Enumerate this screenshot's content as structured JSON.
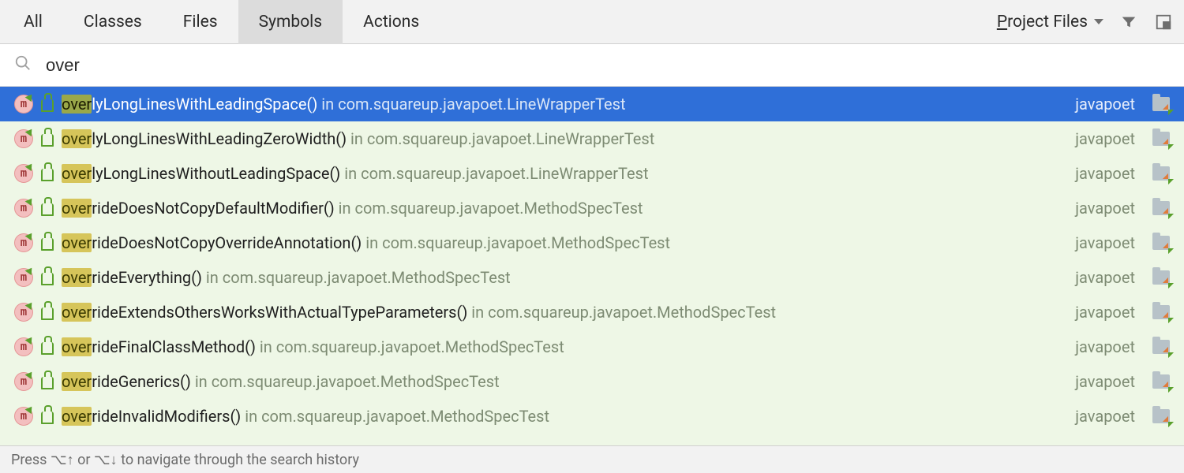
{
  "tabs": {
    "all": "All",
    "classes": "Classes",
    "files": "Files",
    "symbols": "Symbols",
    "actions": "Actions",
    "active": "symbols"
  },
  "scope": {
    "prefix": "P",
    "rest": "roject Files"
  },
  "search": {
    "value": "over",
    "highlight": "over"
  },
  "module": "javapoet",
  "results": [
    {
      "name": "overlyLongLinesWithLeadingSpace()",
      "in": " in com.squareup.javapoet.LineWrapperTest",
      "selected": true
    },
    {
      "name": "overlyLongLinesWithLeadingZeroWidth()",
      "in": " in com.squareup.javapoet.LineWrapperTest",
      "selected": false
    },
    {
      "name": "overlyLongLinesWithoutLeadingSpace()",
      "in": " in com.squareup.javapoet.LineWrapperTest",
      "selected": false
    },
    {
      "name": "overrideDoesNotCopyDefaultModifier()",
      "in": " in com.squareup.javapoet.MethodSpecTest",
      "selected": false
    },
    {
      "name": "overrideDoesNotCopyOverrideAnnotation()",
      "in": " in com.squareup.javapoet.MethodSpecTest",
      "selected": false
    },
    {
      "name": "overrideEverything()",
      "in": " in com.squareup.javapoet.MethodSpecTest",
      "selected": false
    },
    {
      "name": "overrideExtendsOthersWorksWithActualTypeParameters()",
      "in": " in com.squareup.javapoet.MethodSpecTest",
      "selected": false
    },
    {
      "name": "overrideFinalClassMethod()",
      "in": " in com.squareup.javapoet.MethodSpecTest",
      "selected": false
    },
    {
      "name": "overrideGenerics()",
      "in": " in com.squareup.javapoet.MethodSpecTest",
      "selected": false
    },
    {
      "name": "overrideInvalidModifiers()",
      "in": " in com.squareup.javapoet.MethodSpecTest",
      "selected": false
    }
  ],
  "footer": "Press ⌥↑ or ⌥↓ to navigate through the search history"
}
